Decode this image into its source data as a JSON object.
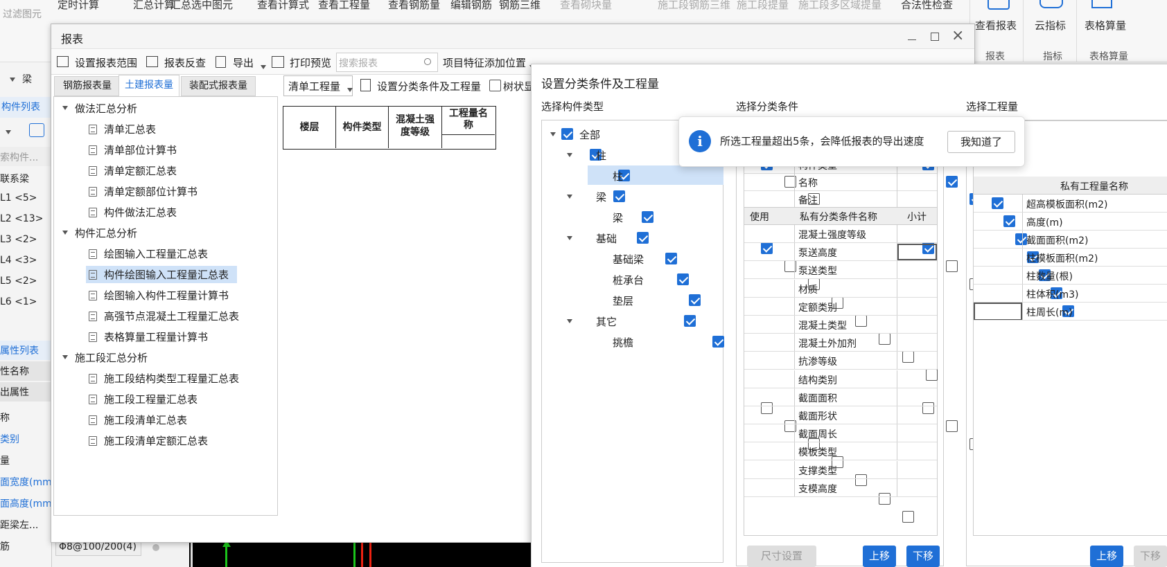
{
  "ribbon": {
    "left_text": "过滤图元",
    "top_labels": [
      "定时计算",
      "汇总计算",
      "汇总选中图元",
      "查看计算式",
      "查看工程量",
      "查看钢筋量",
      "编辑钢筋",
      "钢筋三维",
      "查看砌块量",
      "施工段钢筋三维",
      "施工段提量",
      "施工段多区域提量",
      "合法性检查"
    ],
    "view_report": "查看报表",
    "cloud_index": "云指标",
    "table_calc": "表格算量",
    "group_report": "报表",
    "group_index": "指标",
    "group_table": "表格算量"
  },
  "left_strip": {
    "dropdown": "梁",
    "component_list": "构件列表",
    "search_placeholder": "索构件...",
    "items": [
      "联系梁",
      "L1 <5>",
      "L2 <13>",
      "L3 <2>",
      "L4 <3>",
      "L5 <2>",
      "L6 <1>"
    ],
    "property_list": "属性列表",
    "prop_name": "性名称",
    "basic_attr": "出属性",
    "attrs": [
      "称",
      "类别",
      "量",
      "面宽度(mm)",
      "面高度(mm)",
      "距梁左...",
      "筋"
    ],
    "bottom_value": "Φ8@100/200(4)"
  },
  "report_window": {
    "title": "报表",
    "toolbar": {
      "set_range": "设置报表范围",
      "report_check": "报表反查",
      "export": "导出",
      "print_preview": "打印预览",
      "search_placeholder": "搜索报表",
      "feature_pos": "项目特征添加位置"
    },
    "tabs": [
      "钢筋报表量",
      "土建报表量",
      "装配式报表量"
    ],
    "sub_toolbar": {
      "select_value": "清单工程量",
      "set_condition": "设置分类条件及工程量",
      "tree_display": "树状显"
    },
    "tree": [
      {
        "group": "做法汇总分析",
        "items": [
          "清单汇总表",
          "清单部位计算书",
          "清单定额汇总表",
          "清单定额部位计算书",
          "构件做法汇总表"
        ]
      },
      {
        "group": "构件汇总分析",
        "items": [
          "绘图输入工程量汇总表",
          "构件绘图输入工程量汇总表",
          "绘图输入构件工程量计算书",
          "高强节点混凝土工程量汇总表",
          "表格算量工程量计算书"
        ]
      },
      {
        "group": "施工段汇总分析",
        "items": [
          "施工段结构类型工程量汇总表",
          "施工段工程量汇总表",
          "施工段清单汇总表",
          "施工段清单定额汇总表"
        ]
      }
    ],
    "table_headers": [
      "楼层",
      "构件类型",
      "混凝土强度等级",
      "工程量名称"
    ]
  },
  "settings_dialog": {
    "title": "设置分类条件及工程量",
    "col1_title": "选择构件类型",
    "col2_title": "选择分类条件",
    "col3_title": "选择工程量",
    "comp_tree": [
      {
        "label": "全部",
        "level": 0,
        "checked": true,
        "expander": true
      },
      {
        "label": "柱",
        "level": 1,
        "checked": true,
        "expander": true
      },
      {
        "label": "柱",
        "level": 2,
        "checked": true,
        "expander": false,
        "selected": true
      },
      {
        "label": "梁",
        "level": 1,
        "checked": true,
        "expander": true
      },
      {
        "label": "梁",
        "level": 2,
        "checked": true,
        "expander": false
      },
      {
        "label": "基础",
        "level": 1,
        "checked": true,
        "expander": true
      },
      {
        "label": "基础梁",
        "level": 2,
        "checked": true,
        "expander": false
      },
      {
        "label": "桩承台",
        "level": 2,
        "checked": true,
        "expander": false
      },
      {
        "label": "垫层",
        "level": 2,
        "checked": true,
        "expander": false
      },
      {
        "label": "其它",
        "level": 1,
        "checked": true,
        "expander": true
      },
      {
        "label": "挑檐",
        "level": 2,
        "checked": true,
        "expander": false
      }
    ],
    "public_conditions": [
      {
        "name": "构件类型",
        "use": true,
        "subtotal": true
      },
      {
        "name": "名称",
        "use": false,
        "subtotal": true
      },
      {
        "name": "备注",
        "use": false,
        "subtotal": true
      }
    ],
    "private_header": {
      "use": "使用",
      "name": "私有分类条件名称",
      "subtotal": "小计"
    },
    "private_conditions": [
      {
        "name": "混凝土强度等级",
        "use": true,
        "subtotal": true
      },
      {
        "name": "泵送高度",
        "use": false,
        "subtotal": false
      },
      {
        "name": "泵送类型",
        "use": false,
        "subtotal": false
      },
      {
        "name": "材质",
        "use": false,
        "subtotal": false
      },
      {
        "name": "定额类别",
        "use": false,
        "subtotal": false
      },
      {
        "name": "混凝土类型",
        "use": false,
        "subtotal": false
      },
      {
        "name": "混凝土外加剂",
        "use": false,
        "subtotal": false
      },
      {
        "name": "抗渗等级",
        "use": false,
        "subtotal": false
      },
      {
        "name": "结构类别",
        "use": false,
        "subtotal": false
      },
      {
        "name": "截面面积",
        "use": false,
        "subtotal": false
      },
      {
        "name": "截面形状",
        "use": false,
        "subtotal": false
      },
      {
        "name": "截面周长",
        "use": false,
        "subtotal": false
      },
      {
        "name": "模板类型",
        "use": false,
        "subtotal": false
      },
      {
        "name": "支撑类型",
        "use": false,
        "subtotal": false
      },
      {
        "name": "支模高度",
        "use": false,
        "subtotal": false
      }
    ],
    "qty_header": "私有工程量名称",
    "quantities": [
      {
        "name": "超高模板面积(m2)",
        "checked": true
      },
      {
        "name": "高度(m)",
        "checked": true
      },
      {
        "name": "截面面积(m2)",
        "checked": true
      },
      {
        "name": "柱模板面积(m2)",
        "checked": true
      },
      {
        "name": "柱数量(根)",
        "checked": true
      },
      {
        "name": "柱体积(m3)",
        "checked": true
      },
      {
        "name": "柱周长(m)",
        "checked": true
      }
    ],
    "size_setting": "尺寸设置",
    "move_up": "上移",
    "move_down": "下移",
    "move_up2": "上移",
    "move_down2": "下移"
  },
  "toast": {
    "message": "所选工程量超出5条，会降低报表的导出速度",
    "button": "我知道了"
  },
  "colors": {
    "accent": "#1f6fd6",
    "selection": "#cfe2f8"
  }
}
